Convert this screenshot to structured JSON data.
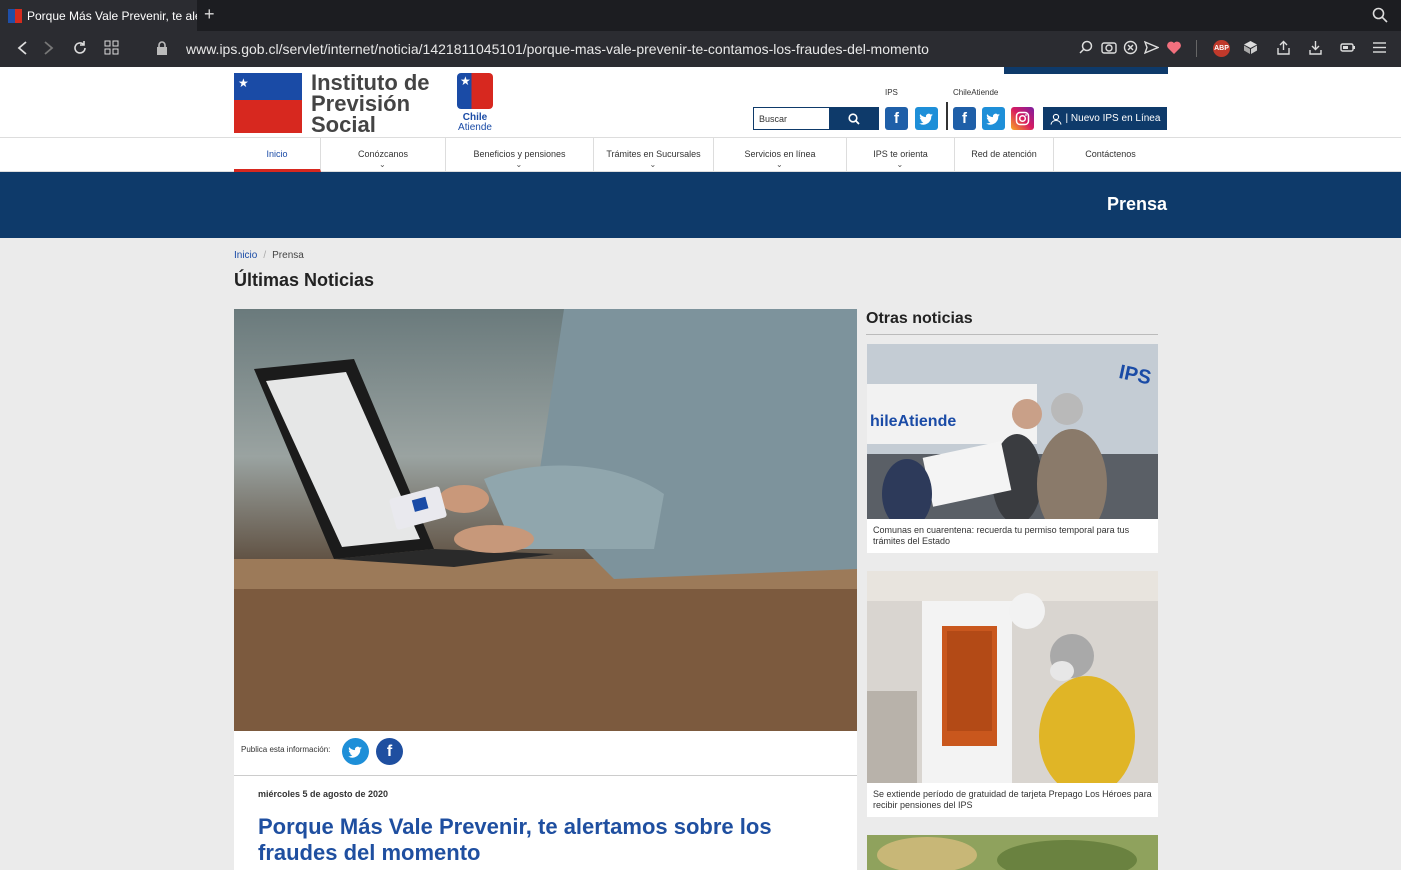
{
  "browser": {
    "tab_title": "Porque Más Vale Prevenir, te ale",
    "new_tab": "+",
    "url": "www.ips.gob.cl/servlet/internet/noticia/1421811045101/porque-mas-vale-prevenir-te-contamos-los-fraudes-del-momento",
    "abp_label": "ABP"
  },
  "header": {
    "logo_lines": [
      "Instituto de",
      "Previsión",
      "Social"
    ],
    "chile_atiende": [
      "Chile",
      "Atiende"
    ],
    "label_ips": "IPS",
    "label_chileatiende": "ChileAtiende",
    "search_placeholder": "Buscar",
    "ips_online": "| Nuevo IPS en Línea"
  },
  "menu": [
    {
      "label": "Inicio"
    },
    {
      "label": "Conózcanos"
    },
    {
      "label": "Beneficios y pensiones"
    },
    {
      "label": "Trámites en Sucursales"
    },
    {
      "label": "Servicios en línea"
    },
    {
      "label": "IPS te orienta"
    },
    {
      "label": "Red de atención"
    },
    {
      "label": "Contáctenos"
    }
  ],
  "banner": {
    "title": "Prensa"
  },
  "breadcrumb": {
    "home": "Inicio",
    "current": "Prensa"
  },
  "latest_heading": "Últimas Noticias",
  "article": {
    "share_label": "Publica esta información:",
    "date": "miércoles 5 de agosto de 2020",
    "title": "Porque Más Vale Prevenir, te alertamos sobre los fraudes del momento"
  },
  "sidebar": {
    "heading": "Otras noticias",
    "news": [
      {
        "caption": "Comunas en cuarentena: recuerda tu permiso temporal para tus trámites del Estado",
        "sign": "hileAtiende",
        "sign2": "IPS"
      },
      {
        "caption": "Se extiende período de gratuidad de tarjeta Prepago Los Héroes para recibir pensiones del IPS"
      },
      {
        "caption": ""
      }
    ]
  },
  "colors": {
    "brand_blue": "#0e3a6a",
    "brand_red": "#d7281f",
    "link_blue": "#1f4fa0"
  }
}
